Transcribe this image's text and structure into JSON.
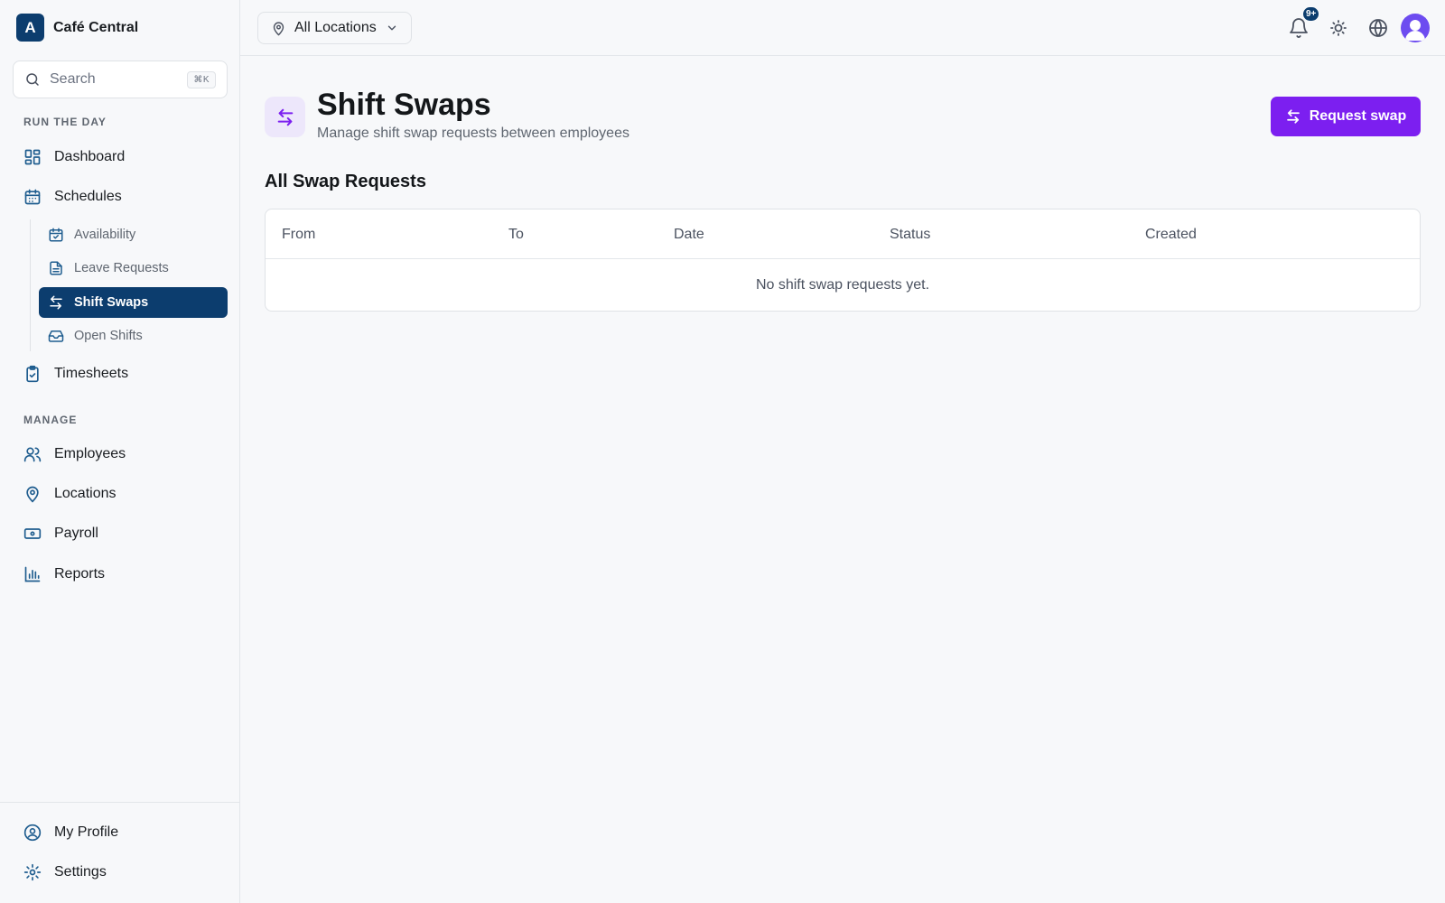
{
  "brand": {
    "logo_letter": "A",
    "name": "Café Central"
  },
  "search": {
    "placeholder": "Search",
    "shortcut": "⌘K"
  },
  "sidebar": {
    "sections": [
      {
        "label": "RUN THE DAY"
      },
      {
        "label": "MANAGE"
      }
    ],
    "items": {
      "dashboard": "Dashboard",
      "schedules": "Schedules",
      "availability": "Availability",
      "leave_requests": "Leave Requests",
      "shift_swaps": "Shift Swaps",
      "open_shifts": "Open Shifts",
      "timesheets": "Timesheets",
      "employees": "Employees",
      "locations": "Locations",
      "payroll": "Payroll",
      "reports": "Reports",
      "my_profile": "My Profile",
      "settings": "Settings"
    },
    "active_item": "shift_swaps"
  },
  "topbar": {
    "location_select": "All Locations",
    "notification_badge": "9+",
    "icons": [
      "bell-icon",
      "sun-icon",
      "globe-icon",
      "avatar"
    ]
  },
  "page": {
    "title": "Shift Swaps",
    "subtitle": "Manage shift swap requests between employees",
    "primary_action": "Request swap",
    "section_title": "All Swap Requests"
  },
  "table": {
    "columns": [
      "From",
      "To",
      "Date",
      "Status",
      "Created"
    ],
    "rows": [],
    "empty_message": "No shift swap requests yet."
  },
  "colors": {
    "brand_navy": "#0c3d6e",
    "accent_purple": "#7c1ff0",
    "icon_blue": "#1f5d8f"
  }
}
